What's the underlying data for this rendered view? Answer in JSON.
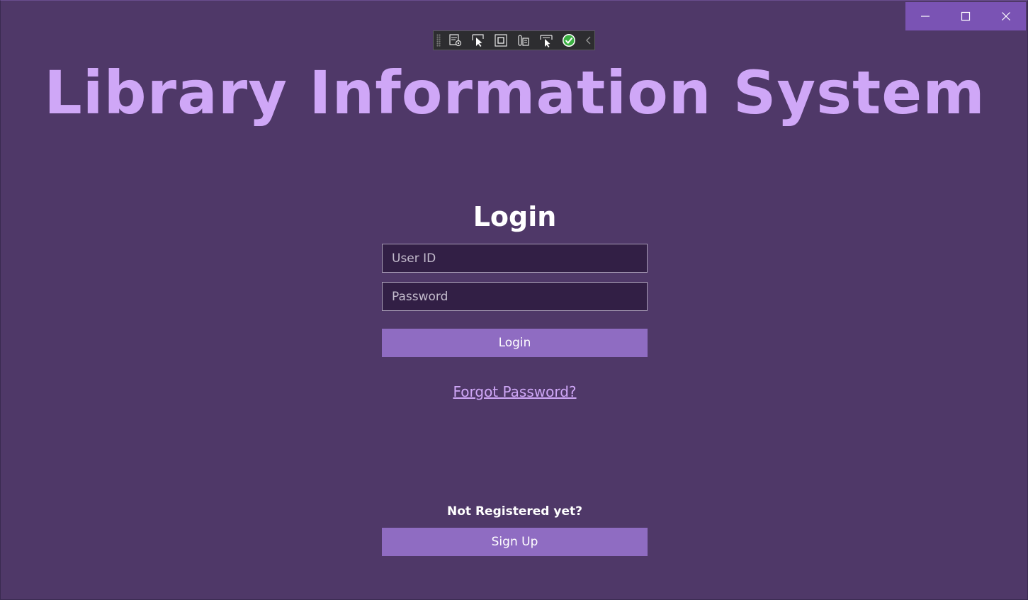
{
  "app": {
    "title": "Library Information System"
  },
  "window_controls": {
    "icons": [
      "minimize-icon",
      "maximize-icon",
      "close-icon"
    ]
  },
  "debug_toolbar": {
    "icons": [
      "live-visual-tree-icon",
      "select-element-icon",
      "display-layout-adorners-icon",
      "track-focus-icon",
      "display-layout-adorners-2-icon",
      "hot-reload-check-icon",
      "collapse-toolbar-icon"
    ]
  },
  "login": {
    "heading": "Login",
    "userid_placeholder": "User ID",
    "password_placeholder": "Password",
    "login_button": "Login",
    "forgot_link": "Forgot Password?"
  },
  "register": {
    "prompt": "Not Registered yet?",
    "signup_button": "Sign Up"
  },
  "colors": {
    "background": "#4f3868",
    "title": "#cfa7f7",
    "button": "#8f6cc2",
    "input_bg": "#321f45",
    "caption_bar": "#7a53b4"
  }
}
